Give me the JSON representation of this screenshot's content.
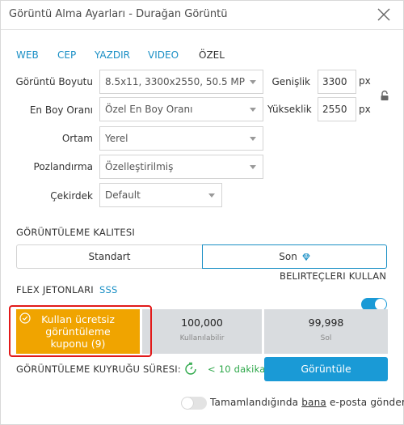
{
  "window": {
    "title": "Görüntü Alma Ayarları - Durağan Görüntü"
  },
  "tabs": [
    {
      "label": "WEB",
      "active": false
    },
    {
      "label": "CEP",
      "active": false
    },
    {
      "label": "YAZDIR",
      "active": false
    },
    {
      "label": "VIDEO",
      "active": false
    },
    {
      "label": "ÖZEL",
      "active": true
    }
  ],
  "settings": {
    "image_size": {
      "label": "Görüntü Boyutu",
      "value": "8.5x11, 3300x2550, 50.5 MP"
    },
    "aspect_ratio": {
      "label": "En Boy Oranı",
      "value": "Özel En Boy Oranı"
    },
    "environment": {
      "label": "Ortam",
      "value": "Yerel"
    },
    "posing": {
      "label": "Pozlandırma",
      "value": "Özelleştirilmiş"
    },
    "seed": {
      "label": "Çekirdek",
      "value": "Default"
    },
    "width": {
      "label": "Genişlik",
      "value": "3300",
      "unit": "px"
    },
    "height": {
      "label": "Yükseklik",
      "value": "2550",
      "unit": "px"
    }
  },
  "quality": {
    "title": "GÖRÜNTÜLEME KALITESI",
    "standard_label": "Standart",
    "final_label": "Son",
    "selected": "final",
    "markers_label": "BELIRTEÇLERI KULLAN",
    "markers_enabled": true
  },
  "tokens": {
    "title": "FLEX JETONLARI",
    "faq_label": "SSS",
    "free_button_label": "Kullan ücretsiz görüntüleme kuponu (9)",
    "available_value": "100,000",
    "available_label": "Kullanılabilir",
    "final_value": "99,998",
    "final_label": "Sol"
  },
  "queue": {
    "label": "GÖRÜNTÜLEME KUYRUĞU SÜRESI:",
    "time": "< 10 dakika",
    "render_button_label": "Görüntüle"
  },
  "email": {
    "prefix": "Tamamlandığında",
    "link": "bana",
    "suffix": "e-posta gönder",
    "enabled": false
  },
  "colors": {
    "accent": "#1a8fc5",
    "coupon": "#f0a400",
    "highlight": "#e21a1a",
    "queue_green": "#2ea84a"
  }
}
